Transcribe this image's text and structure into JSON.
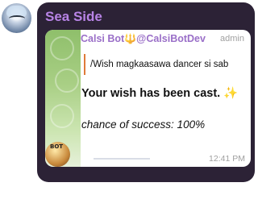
{
  "chat": {
    "group_name": "Sea Side"
  },
  "message": {
    "sender_name": "Calsi Bot",
    "sender_emoji": "🔱",
    "sender_handle": "@CalsiBotDev",
    "role": "admin",
    "reply_text": "/Wish magkaasawa dancer si sab",
    "result_text": "Your wish has been cast.",
    "result_emoji": "✨",
    "chance_text": "chance of success: 100%",
    "time": "12:41 PM",
    "bot_avatar_label": "BOT"
  },
  "colors": {
    "panel": "#2c2236",
    "accent_purple": "#b884e6",
    "sender_purple": "#9a6fc8",
    "reply_bar": "#e07a3a",
    "meta_gray": "#a0a0a0"
  },
  "icons": {
    "sender_badge": "trident-icon",
    "result_badge": "sparkles-icon"
  }
}
